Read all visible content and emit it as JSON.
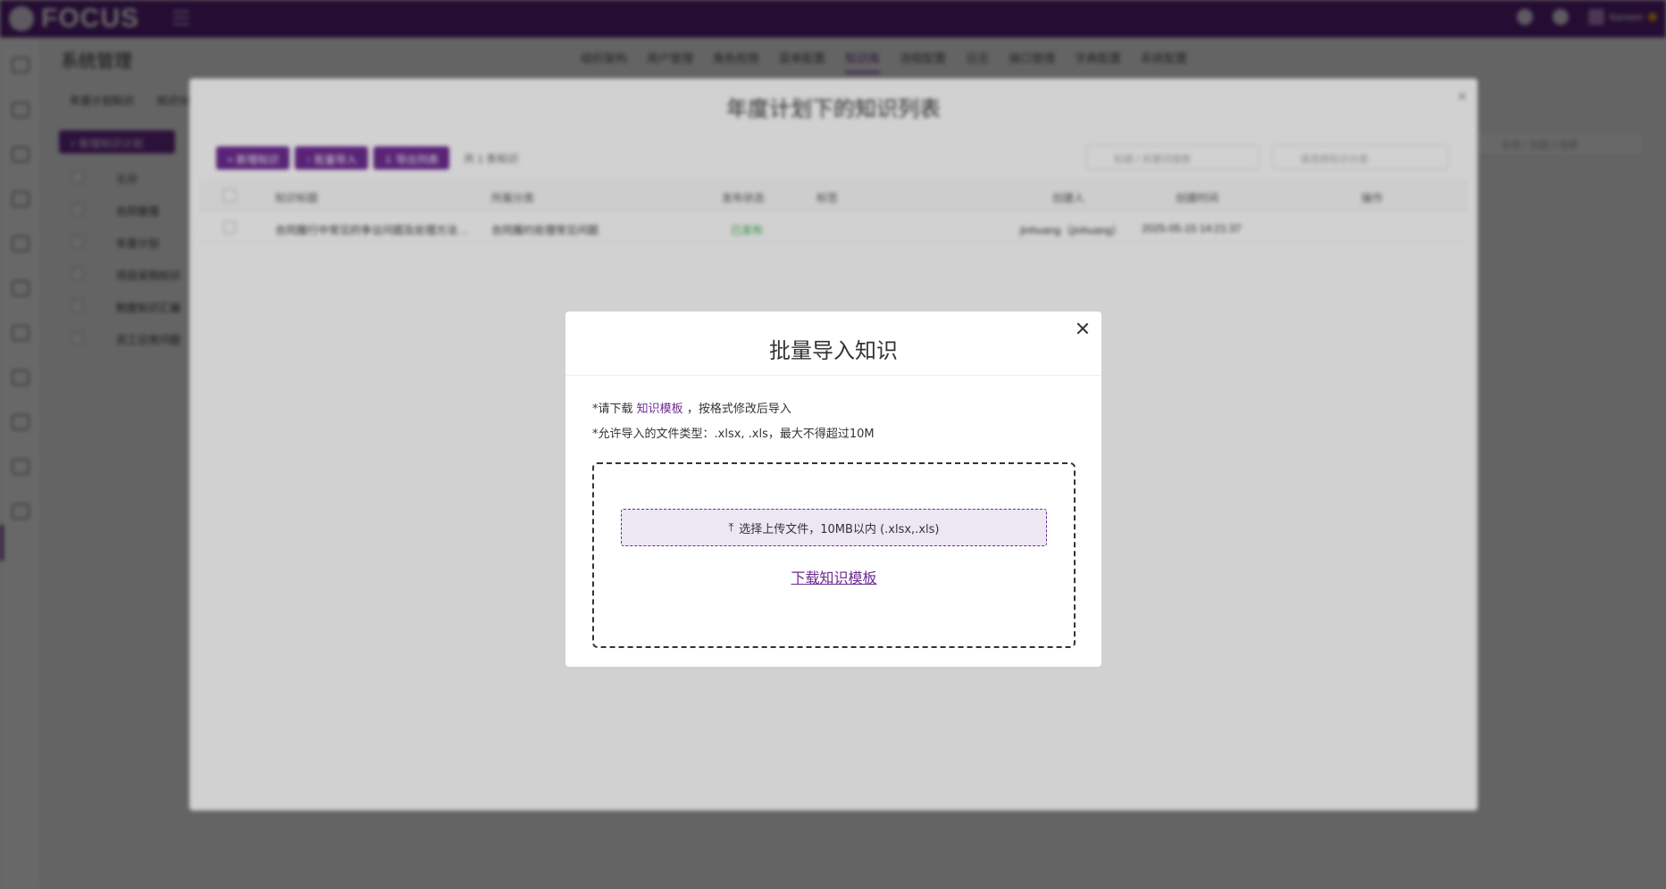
{
  "app": {
    "logo_text": "FOCUS",
    "page_title": "系统管理",
    "user_name": "tianwei"
  },
  "tabs": [
    "组织架构",
    "用户管理",
    "角色权限",
    "菜单配置",
    "知识库",
    "流程配置",
    "日志",
    "接口管理",
    "字典配置",
    "系统配置"
  ],
  "active_tab_index": 4,
  "sub_tabs": [
    "年度计划知识",
    "知识分类"
  ],
  "background_page": {
    "new_button": "+ 新增知识计划",
    "column_header": "名称",
    "rows": [
      "合同管理",
      "年度计划",
      "项目采购知识",
      "制度知识汇编",
      "员工日常问题"
    ],
    "search_placeholder": "名称 / 创建人搜索"
  },
  "big_modal": {
    "title": "年度计划下的知识列表",
    "buttons": [
      "+ 新增知识",
      "↑ 批量导入",
      "⇩ 导出列表"
    ],
    "count": "共 1 条知识",
    "filter1_placeholder": "标题 / 关键词搜索",
    "filter2_placeholder": "请选择知识分类",
    "columns": [
      "知识标题",
      "所属分类",
      "发布状态",
      "标签",
      "创建人",
      "创建时间",
      "操作"
    ],
    "row": {
      "title": "合同履行中常见的争议问题及处理方法详细说明",
      "category": "合同履约处理常见问题",
      "status": "已发布",
      "creator": "jinhuang（jinhuang）",
      "time": "2025-05-15 14:21:37"
    }
  },
  "dialog": {
    "title": "批量导入知识",
    "tip1_prefix": "*请下载",
    "tip1_link": "知识模板",
    "tip1_suffix": "，按格式修改后导入",
    "tip2": "*允许导入的文件类型：.xlsx, .xls，最大不得超过10M",
    "upload_icon": "⤒",
    "upload_label": "选择上传文件，10MB以内 (.xlsx,.xls)",
    "download_link": "下载知识模板"
  }
}
